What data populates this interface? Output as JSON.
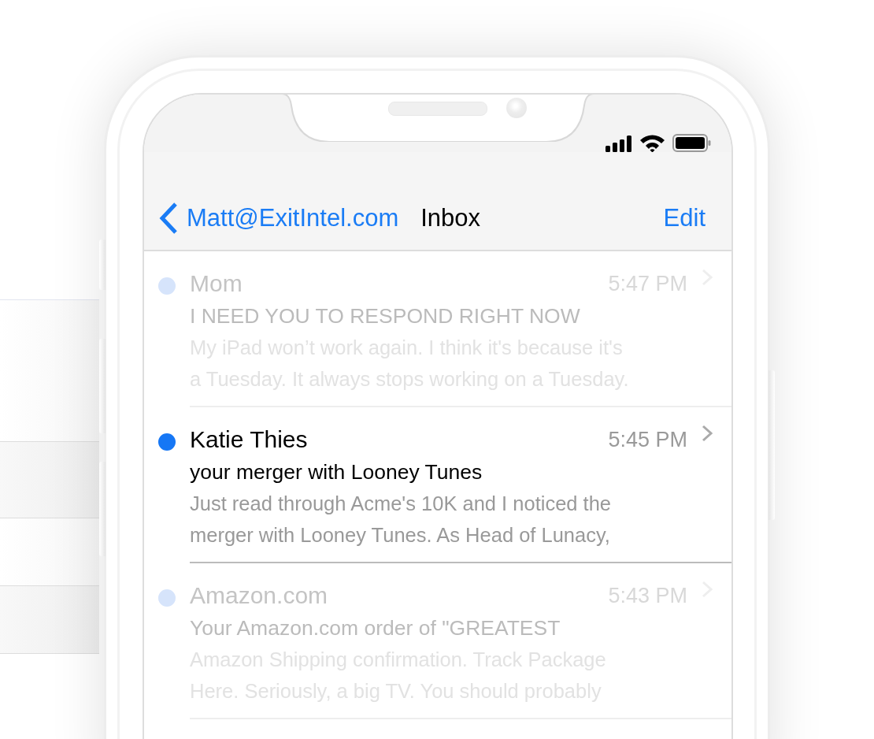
{
  "nav": {
    "back_label": "Matt@ExitIntel.com",
    "title": "Inbox",
    "action": "Edit"
  },
  "messages": [
    {
      "sender": "Mom",
      "time": "5:47 PM",
      "subject": "I NEED YOU TO RESPOND RIGHT NOW",
      "preview_lines": [
        "My iPad won’t work again. I think it's because it's",
        "a Tuesday. It always stops working on a Tuesday."
      ],
      "unread": true,
      "selected": false
    },
    {
      "sender": "Katie Thies",
      "time": "5:45 PM",
      "subject": "your merger with Looney Tunes",
      "preview_lines": [
        "Just read through Acme's 10K and I noticed the",
        "merger with Looney Tunes. As Head of Lunacy,"
      ],
      "unread": true,
      "selected": true
    },
    {
      "sender": "Amazon.com",
      "time": "5:43 PM",
      "subject": "Your Amazon.com order of \"GREATEST",
      "preview_lines": [
        "Amazon Shipping confirmation. Track Package",
        "Here. Seriously, a big TV. You should probably"
      ],
      "unread": true,
      "selected": false
    }
  ]
}
